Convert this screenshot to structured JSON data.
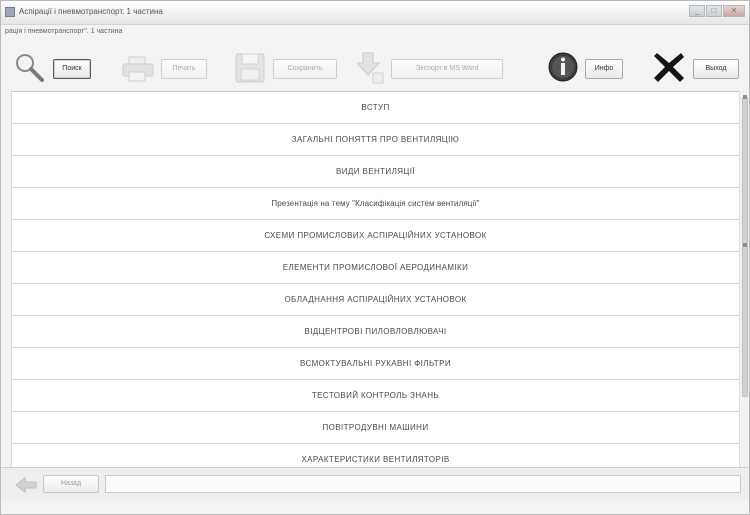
{
  "window": {
    "title": "Аспірації і пневмотранспорт. 1 частина",
    "subtitle": "рація і пневмотранспорт\". 1 частина",
    "controls": [
      "_",
      "□",
      "✕"
    ]
  },
  "toolbar": {
    "search_label": "Поиск",
    "print_label": "Печать",
    "save_label": "Сохранить",
    "export_label": "Экспорт в MS Word",
    "info_label": "Инфо",
    "exit_label": "Выход"
  },
  "sections": [
    "ВСТУП",
    "ЗАГАЛЬНІ ПОНЯТТЯ ПРО ВЕНТИЛЯЦІЮ",
    "ВИДИ  ВЕНТИЛЯЦІЇ",
    "Презентація на тему \"Класифікація систем вентиляції\"",
    "СХЕМИ ПРОМИСЛОВИХ АСПІРАЦІЙНИХ УСТАНОВОК",
    "ЕЛЕМЕНТИ ПРОМИСЛОВОЇ АЕРОДИНАМІКИ",
    "ОБЛАДНАННЯ АСПІРАЦІЙНИХ УСТАНОВОК",
    "ВІДЦЕНТРОВІ ПИЛОВЛОВЛЮВАЧІ",
    "ВСМОКТУВАЛЬНІ РУКАВНІ ФІЛЬТРИ",
    "ТЕСТОВИЙ КОНТРОЛЬ ЗНАНЬ",
    "ПОВІТРОДУВНІ МАШИНИ",
    "ХАРАКТЕРИСТИКИ ВЕНТИЛЯТОРІВ"
  ],
  "bottom": {
    "back_label": "Назад",
    "status_text": ""
  },
  "icons": {
    "search": "magnifier-icon",
    "print": "printer-icon",
    "save": "floppy-disk-icon",
    "export": "export-arrow-icon",
    "info": "info-icon",
    "exit": "x-exit-icon",
    "back": "back-arrow-icon"
  }
}
